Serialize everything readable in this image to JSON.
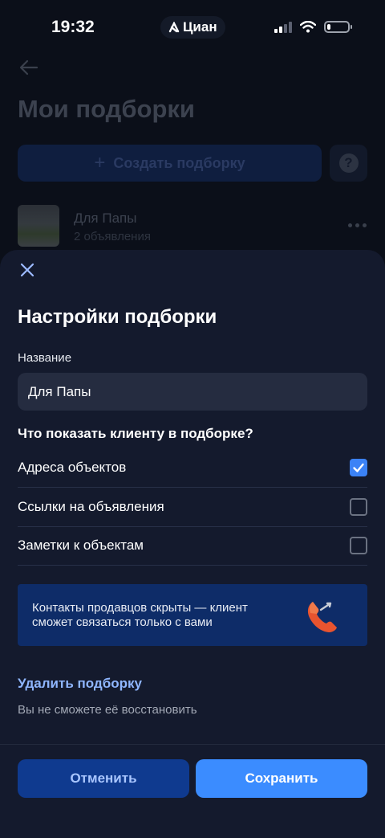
{
  "status_bar": {
    "time": "19:32",
    "app_badge": "Циан",
    "battery_percent": 15
  },
  "background_page": {
    "title": "Мои подборки",
    "create_button_label": "Создать подборку",
    "help_label": "?",
    "collection": {
      "name": "Для Папы",
      "count": "2 объявления"
    }
  },
  "sheet": {
    "title": "Настройки подборки",
    "name_field": {
      "label": "Название",
      "value": "Для Папы"
    },
    "question": "Что показать клиенту в подборке?",
    "options": [
      {
        "label": "Адреса объектов",
        "checked": true
      },
      {
        "label": "Ссылки на объявления",
        "checked": false
      },
      {
        "label": "Заметки к объектам",
        "checked": false
      }
    ],
    "info_banner": "Контакты продавцов скрыты — клиент сможет связаться только с вами",
    "delete_link": "Удалить подборку",
    "delete_hint": "Вы не сможете её восстановить",
    "cancel_button": "Отменить",
    "save_button": "Сохранить"
  },
  "colors": {
    "background": "#0b0f19",
    "sheet": "#141a2d",
    "accent": "#3b8cff",
    "banner": "#0e2c68",
    "link": "#8fb6ff"
  }
}
